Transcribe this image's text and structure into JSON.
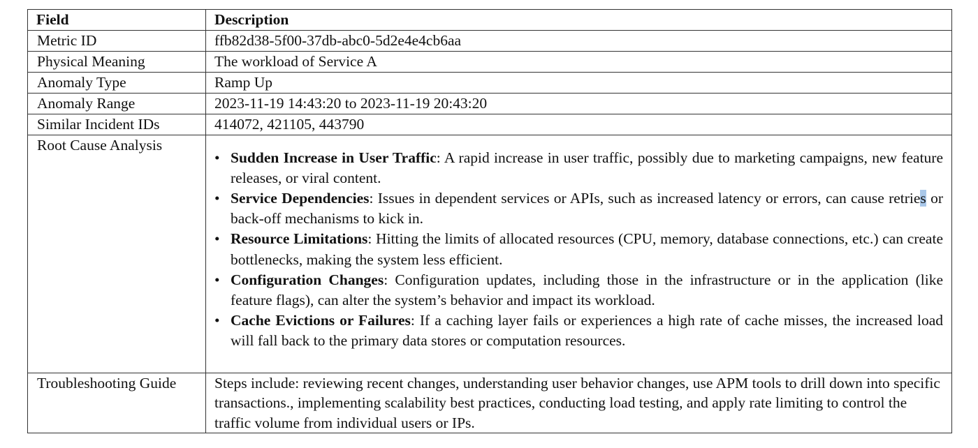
{
  "table": {
    "headers": {
      "field": "Field",
      "description": "Description"
    },
    "rows": [
      {
        "field": "Metric ID",
        "value": "ffb82d38-5f00-37db-abc0-5d2e4e4cb6aa"
      },
      {
        "field": "Physical Meaning",
        "value": "The workload of Service A"
      },
      {
        "field": "Anomaly Type",
        "value": "Ramp Up"
      },
      {
        "field": "Anomaly Range",
        "value": "2023-11-19 14:43:20 to 2023-11-19 20:43:20"
      },
      {
        "field": "Similar Incident IDs",
        "value": "414072, 421105, 443790"
      }
    ],
    "root_cause": {
      "field": "Root Cause Analysis",
      "bullet": "•",
      "items": [
        {
          "term": "Sudden Increase in User Traffic",
          "text": ": A rapid increase in user traffic, possibly due to marketing campaigns, new feature releases, or viral content."
        },
        {
          "term": "Service Dependencies",
          "text_before": ": Issues in dependent services or APIs, such as increased latency or errors, can cause retrie",
          "selected": "s",
          "text_after": " or back-off mechanisms to kick in."
        },
        {
          "term": "Resource Limitations",
          "text": ": Hitting the limits of allocated resources (CPU, memory, database connections, etc.) can create bottlenecks, making the system less efficient."
        },
        {
          "term": "Configuration Changes",
          "text": ": Configuration updates, including those in the infrastructure or in the application (like feature flags), can alter the system’s behavior and impact its workload."
        },
        {
          "term": "Cache Evictions or Failures",
          "text": ": If a caching layer fails or experiences a high rate of cache misses, the increased load will fall back to the primary data stores or computation resources."
        }
      ]
    },
    "guide": {
      "field": "Troubleshooting Guide",
      "value": "Steps include: reviewing recent changes, understanding user behavior changes, use APM tools to drill down into specific transactions., implementing scalability best practices, conducting load testing, and apply rate limiting to control the traffic volume from individual users or IPs."
    }
  },
  "colors": {
    "border": "#333333",
    "selection": "#a9c8ea"
  }
}
